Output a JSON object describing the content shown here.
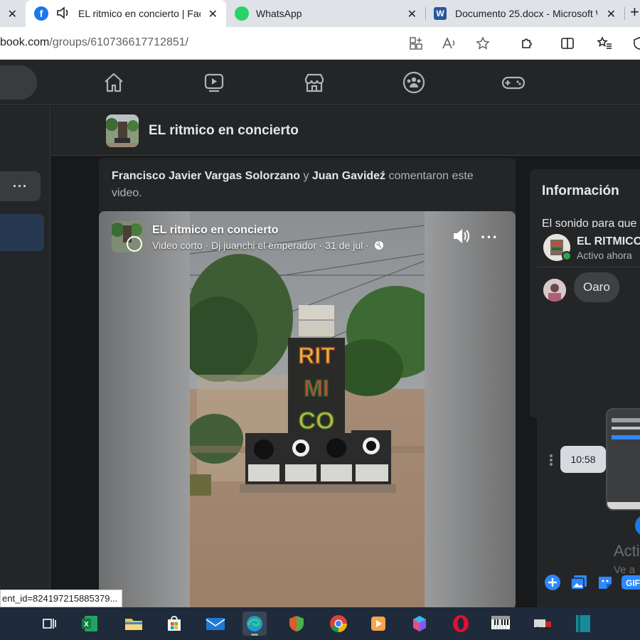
{
  "browser": {
    "tabs": [
      {
        "title": "",
        "state": "partial"
      },
      {
        "title": "EL ritmico en concierto | Fac",
        "state": "active"
      },
      {
        "title": "WhatsApp",
        "state": "inactive"
      },
      {
        "title": "Documento 25.docx - Microsoft W",
        "state": "inactive"
      }
    ],
    "new_tab_glyph": "+",
    "url_host": "book.com",
    "url_path": "/groups/610736617712851/"
  },
  "fb_nav": {
    "icons": [
      "home-icon",
      "watch-icon",
      "marketplace-icon",
      "groups-icon",
      "gaming-icon"
    ]
  },
  "left_col": {
    "more_label": "···"
  },
  "group": {
    "title": "EL ritmico en concierto"
  },
  "post": {
    "commenter1": "Francisco Javier Vargas Solorzano",
    "connector": " y ",
    "commenter2": "Juan Gavideź",
    "action": " comentaron este video.",
    "video": {
      "title": "EL ritmico en concierto",
      "meta": "Video corto · Dj juanchi el emperador · 31 de jul ·",
      "speaker_letters": [
        "RIT",
        "MI",
        "CO"
      ]
    }
  },
  "info": {
    "title": "Información",
    "subtitle": "El sonido para que"
  },
  "chat": {
    "name": "EL RITMICO",
    "status": "Activo ahora",
    "message": "Oaro",
    "time": "10:58",
    "ghost_big": "Acti",
    "ghost_small": "Ve a"
  },
  "status_url": "ent_id=824197215885379...",
  "colors": {
    "fb_blue": "#1877f2",
    "dark_bg": "#18191a",
    "card_bg": "#242526"
  }
}
